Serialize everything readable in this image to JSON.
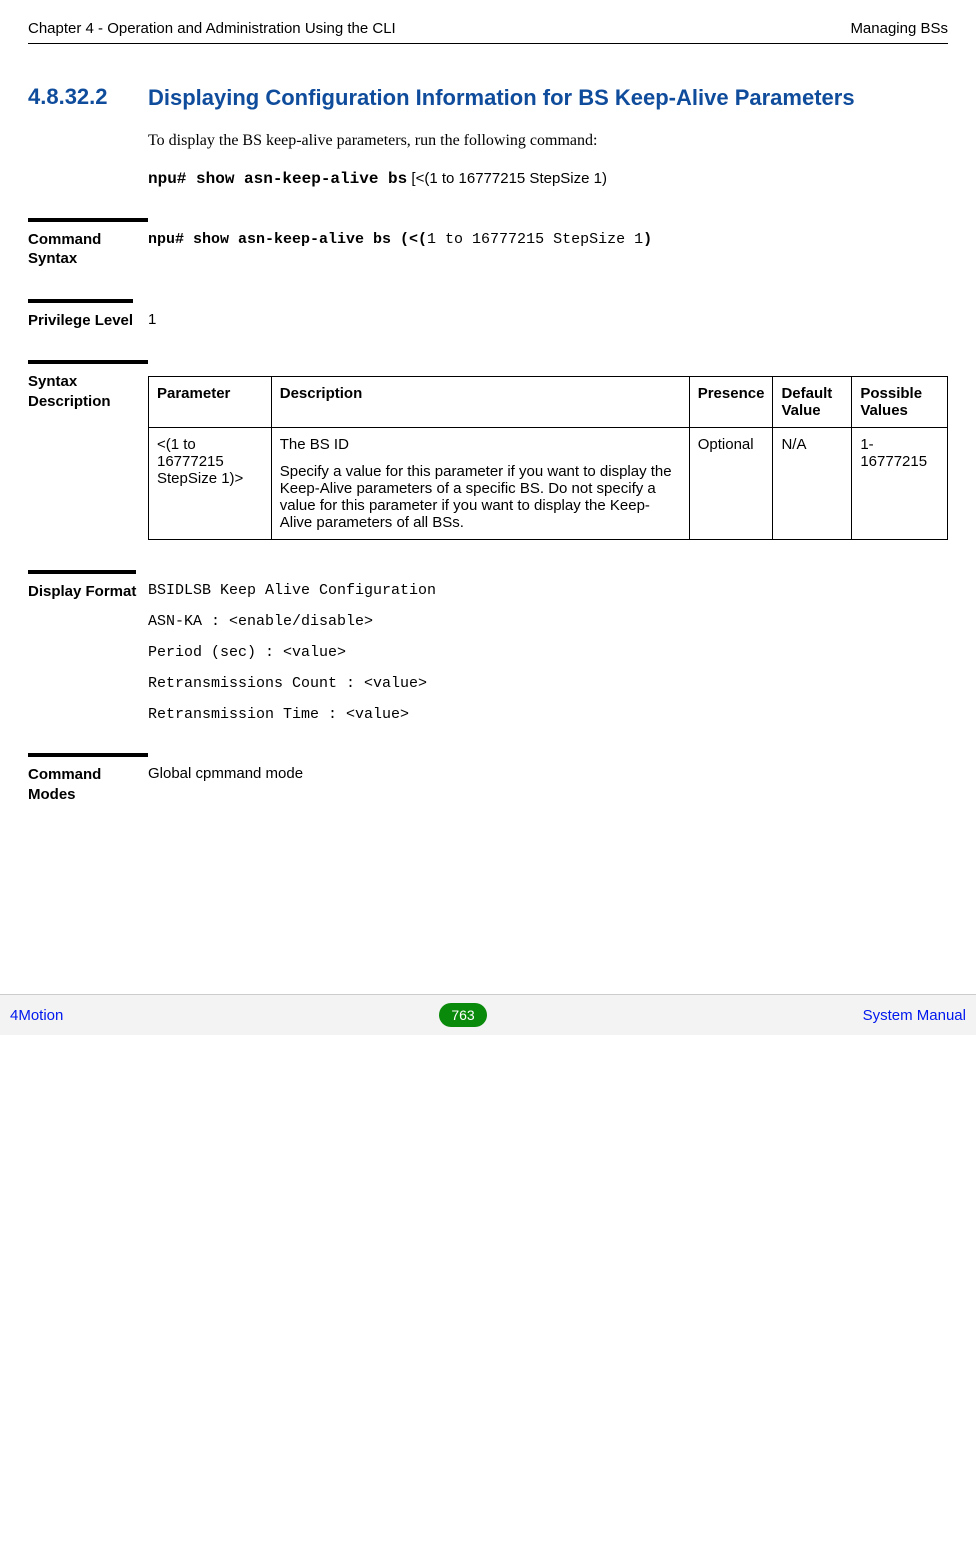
{
  "header": {
    "left": "Chapter 4 - Operation and Administration Using the CLI",
    "right": "Managing BSs"
  },
  "section": {
    "number": "4.8.32.2",
    "title": "Displaying Configuration Information for BS Keep-Alive Parameters",
    "intro": " To display the BS keep-alive parameters, run the following command:",
    "cmd_bold": "npu# show asn-keep-alive bs",
    "cmd_trail": " [<(1 to 16777215 StepSize 1)"
  },
  "command_syntax": {
    "label": "Command Syntax",
    "value_bold_a": "npu# show asn-keep-alive bs (<(",
    "value_mid": "1 to 16777215 StepSize 1",
    "value_bold_b": ")"
  },
  "privilege": {
    "label": "Privilege Level",
    "value": "1"
  },
  "syntax_desc": {
    "label": "Syntax Description",
    "headers": {
      "param": "Parameter",
      "desc": "Description",
      "presence": "Presence",
      "default": "Default Value",
      "possible": "Possible Values"
    },
    "row": {
      "param": "<(1 to 16777215 StepSize 1)>",
      "desc_line1": "The BS ID",
      "desc_line2": "Specify a value for this parameter if you want to display the Keep-Alive parameters of a specific BS. Do not specify a value for this parameter if you want to display the Keep-Alive parameters of all BSs.",
      "presence": "Optional",
      "default": "N/A",
      "possible": "1-16777215"
    }
  },
  "display_format": {
    "label": "Display Format",
    "lines": {
      "l1": "BSIDLSB Keep Alive Configuration",
      "l2": "ASN-KA : <enable/disable>",
      "l3": "Period (sec) : <value>",
      "l4": "Retransmissions Count : <value>",
      "l5": "Retransmission Time : <value>"
    }
  },
  "command_modes": {
    "label": "Command Modes",
    "value": "Global cpmmand mode"
  },
  "footer": {
    "left": "4Motion",
    "page": "763",
    "right": "System Manual"
  }
}
